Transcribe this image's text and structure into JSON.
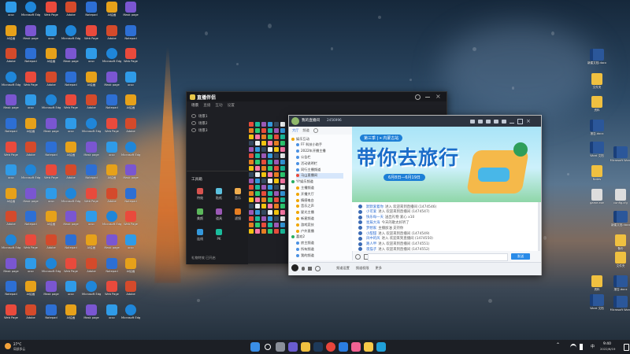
{
  "wallpaper": {
    "scene": "tokyo-tower-rain"
  },
  "desktop_left": [
    {
      "label": "ucuc",
      "color": "#2f9be8",
      "icon": "app-icon"
    },
    {
      "label": "Ai绘画",
      "color": "#e6a11a",
      "icon": "app-icon"
    },
    {
      "label": "Adobe",
      "color": "#d44a2b",
      "icon": "app-icon"
    },
    {
      "label": "Microsoft Edge",
      "color": "#1f86d9",
      "icon": "edge-icon"
    },
    {
      "label": "Mask page",
      "color": "#7a56d1",
      "icon": "app-icon"
    },
    {
      "label": "Notepad",
      "color": "#2d6fd4",
      "icon": "app-icon"
    },
    {
      "label": "Web Page",
      "color": "#e94a3c",
      "icon": "app-icon"
    }
  ],
  "chat_window": {
    "title": "我的直播间",
    "tabs": [
      "大厅",
      "频道"
    ],
    "room_id": "2456996",
    "banner": {
      "subtitle": "第三季",
      "location": "内蒙古站",
      "headline": "带你去旅行",
      "dates": "6月8日—6月19日"
    },
    "tree": [
      {
        "label": "娱乐互动",
        "color": "#f0a500"
      },
      {
        "label": "FF 科技小助手",
        "color": "#4a90e2"
      },
      {
        "label": "2022年开播主播",
        "color": "#4a90e2"
      },
      {
        "label": "公告栏",
        "color": "#4a90e2"
      },
      {
        "label": "活动说明栏",
        "color": "#4a90e2"
      },
      {
        "label": "同行主播频道",
        "color": "#4a90e2"
      },
      {
        "label": "马山直播间",
        "color": "#e94a3c"
      },
      {
        "label": "YY娱乐频道",
        "color": "#27ae60"
      },
      {
        "label": "主播频道",
        "color": "#f0a500"
      },
      {
        "label": "开播大厅",
        "color": "#f0a500"
      },
      {
        "label": "情感电台",
        "color": "#f0a500"
      },
      {
        "label": "音乐之声",
        "color": "#f0a500"
      },
      {
        "label": "星光主播",
        "color": "#f0a500"
      },
      {
        "label": "新星频道",
        "color": "#f0a500"
      },
      {
        "label": "游戏竞技",
        "color": "#f0a500"
      },
      {
        "label": "户外直播",
        "color": "#f0a500"
      },
      {
        "label": "喜欢2",
        "color": "#27ae60"
      },
      {
        "label": "房主频道",
        "color": "#4a90e2"
      },
      {
        "label": "所有频道",
        "color": "#4a90e2"
      },
      {
        "label": "我的频道",
        "color": "#4a90e2"
      }
    ],
    "messages": [
      {
        "user": "默默爱着你",
        "text": "进入 欢迎来到直播间 (1474546)"
      },
      {
        "user": "小可爱",
        "text": "进入 欢迎来到直播间 (1474547)"
      },
      {
        "user": "快乐每一天",
        "text": "送出礼物 爱心 x10"
      },
      {
        "user": "星辰大海",
        "text": "今天的歌太好听了"
      },
      {
        "user": "梦想家",
        "text": "主播加油 支持你"
      },
      {
        "user": "小甜甜",
        "text": "进入 欢迎来到直播间 (1474549)"
      },
      {
        "user": "风中的风",
        "text": "进入 欢迎来到直播间 (1474550)"
      },
      {
        "user": "路人甲",
        "text": "进入 欢迎来到直播间 (1474551)"
      },
      {
        "user": "夜猫子",
        "text": "进入 欢迎来到直播间 (1474552)"
      }
    ],
    "bottom_buttons": [
      "频道设置",
      "频道权限",
      "更多"
    ],
    "send_button": "发送"
  },
  "dark_window": {
    "title": "直播伴侣",
    "menu": [
      "场景",
      "直播",
      "互动",
      "设置"
    ],
    "sidebar": [
      "场景1",
      "场景2",
      "场景3"
    ],
    "tools": [
      "工具箱",
      "特效",
      "贴纸",
      "音乐",
      "美颜",
      "道具",
      "滤镜",
      "连线",
      "PK"
    ],
    "footer": "礼物特效 已开启"
  },
  "desktop_right": [
    {
      "label": "新建文档.docx",
      "color": "#2b579a",
      "icon": "word-icon"
    },
    {
      "label": "文件夹",
      "color": "#f0c040",
      "icon": "folder-icon"
    },
    {
      "label": "资料",
      "color": "#f0c040",
      "icon": "folder-icon"
    },
    {
      "label": "报告.docx",
      "color": "#2b579a",
      "icon": "word-icon"
    },
    {
      "label": "Word 文档",
      "color": "#2b579a",
      "icon": "word-icon"
    },
    {
      "label": "Microsoft Word",
      "color": "#2b579a",
      "icon": "word-icon"
    },
    {
      "label": "Notes",
      "color": "#f0c040",
      "icon": "folder-icon"
    },
    {
      "label": "game.exe",
      "color": "#dddddd",
      "icon": "file-icon"
    },
    {
      "label": "config.cfg",
      "color": "#dddddd",
      "icon": "file-icon"
    },
    {
      "label": "备份",
      "color": "#f0c040",
      "icon": "folder-icon"
    }
  ],
  "taskbar": {
    "weather": {
      "temp": "27°C",
      "desc": "局部多云"
    },
    "clock": {
      "time": "9:40",
      "date": "2022/6/19"
    },
    "lang": "中"
  }
}
